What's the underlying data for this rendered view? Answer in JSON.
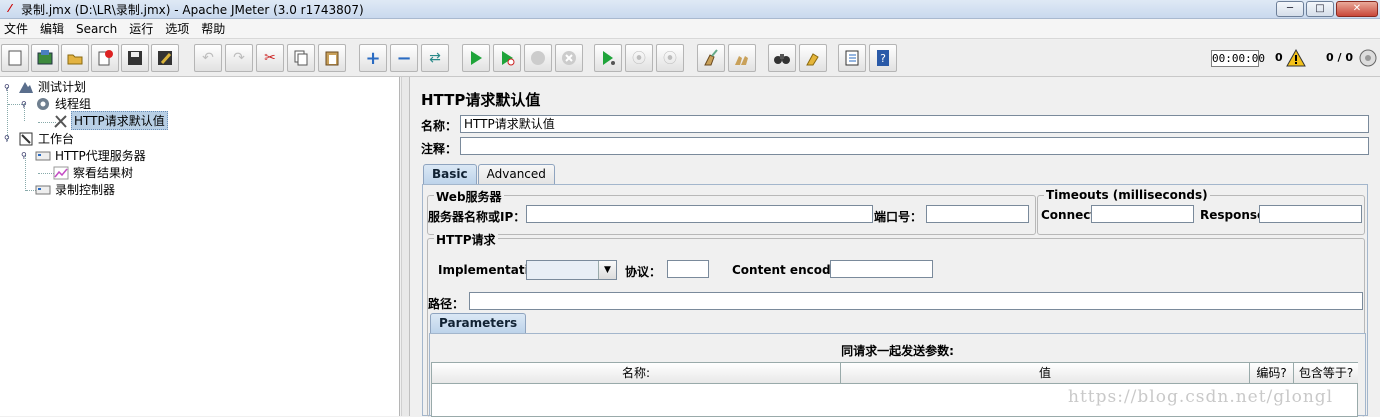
{
  "window": {
    "title": "录制.jmx (D:\\LR\\录制.jmx) - Apache JMeter (3.0 r1743807)",
    "controls": [
      "─",
      "□",
      "✕"
    ]
  },
  "menu": [
    "文件",
    "编辑",
    "Search",
    "运行",
    "选项",
    "帮助"
  ],
  "toolbar": {
    "timer": "00:00:00",
    "warnings": "0",
    "threads": "0 / 0"
  },
  "tree": {
    "items": [
      {
        "label": "测试计划",
        "icon": "test-plan-icon"
      },
      {
        "label": "线程组",
        "icon": "gear-icon"
      },
      {
        "label": "HTTP请求默认值",
        "icon": "tools-icon"
      },
      {
        "label": "工作台",
        "icon": "workbench-icon"
      },
      {
        "label": "HTTP代理服务器",
        "icon": "proxy-icon"
      },
      {
        "label": "察看结果树",
        "icon": "chart-icon"
      },
      {
        "label": "录制控制器",
        "icon": "controller-icon"
      }
    ]
  },
  "panel": {
    "title": "HTTP请求默认值",
    "name_label": "名称：",
    "name_value": "HTTP请求默认值",
    "comment_label": "注释：",
    "comment_value": "",
    "tabs": [
      "Basic",
      "Advanced"
    ],
    "web_server": {
      "legend": "Web服务器",
      "server_label": "服务器名称或IP：",
      "server_value": "",
      "port_label": "端口号：",
      "port_value": ""
    },
    "timeouts": {
      "legend": "Timeouts (milliseconds)",
      "connect_label": "Connect:",
      "connect_value": "",
      "response_label": "Response:",
      "response_value": ""
    },
    "http_request": {
      "legend": "HTTP请求",
      "implementation_label": "Implementation:",
      "implementation_value": "",
      "protocol_label": "协议：",
      "protocol_value": "",
      "encoding_label": "Content encoding:",
      "encoding_value": "",
      "path_label": "路径：",
      "path_value": ""
    },
    "params_tab": "Parameters",
    "params_caption": "同请求一起发送参数:",
    "params_columns": [
      "名称:",
      "值",
      "编码?",
      "包含等于?"
    ]
  },
  "watermark": "https://blog.csdn.net/glongl"
}
